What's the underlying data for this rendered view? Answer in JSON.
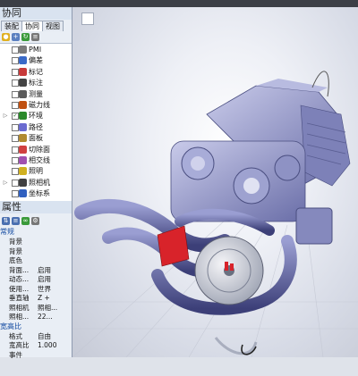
{
  "window": {
    "title": ""
  },
  "left_panel": {
    "title": "协同",
    "tabs": [
      "装配",
      "协同",
      "视图"
    ],
    "active_tab": 1,
    "tree": [
      {
        "label": "PMI",
        "checked": false,
        "expander": "",
        "icon_color": "#7a7a7a"
      },
      {
        "label": "偏差",
        "checked": false,
        "expander": "",
        "icon_color": "#3a6ac8"
      },
      {
        "label": "标记",
        "checked": false,
        "expander": "",
        "icon_color": "#c83a3a"
      },
      {
        "label": "标注",
        "checked": false,
        "expander": "",
        "icon_color": "#444"
      },
      {
        "label": "测量",
        "checked": false,
        "expander": "",
        "icon_color": "#5a5a5a"
      },
      {
        "label": "磁力线",
        "checked": false,
        "expander": "",
        "icon_color": "#c05010"
      },
      {
        "label": "环境",
        "checked": true,
        "expander": "▷",
        "icon_color": "#2a8a2a"
      },
      {
        "label": "路径",
        "checked": false,
        "expander": "",
        "icon_color": "#6a6ad0"
      },
      {
        "label": "面板",
        "checked": false,
        "expander": "",
        "icon_color": "#b08a30"
      },
      {
        "label": "切除面",
        "checked": false,
        "expander": "",
        "icon_color": "#d04040"
      },
      {
        "label": "相交线",
        "checked": false,
        "expander": "",
        "icon_color": "#a050b0"
      },
      {
        "label": "照明",
        "checked": false,
        "expander": "",
        "icon_color": "#d0b020"
      },
      {
        "label": "照相机",
        "checked": false,
        "expander": "▷",
        "icon_color": "#404040"
      },
      {
        "label": "坐标系",
        "checked": false,
        "expander": "",
        "icon_color": "#3060c0"
      }
    ],
    "properties_title": "属性",
    "properties": {
      "section1": "常规",
      "rows1": [
        {
          "k": "背景",
          "v": ""
        },
        {
          "k": "背景",
          "v": ""
        },
        {
          "k": "底色",
          "v": ""
        },
        {
          "k": "背面...",
          "v": "启用"
        },
        {
          "k": "动态...",
          "v": "启用"
        },
        {
          "k": "使用...",
          "v": "世界"
        },
        {
          "k": "垂直轴",
          "v": "Z +"
        },
        {
          "k": "照相机",
          "v": "照相..."
        },
        {
          "k": "照相...",
          "v": "22..."
        }
      ],
      "section2": "宽高比",
      "rows2": [
        {
          "k": "格式",
          "v": "自由"
        },
        {
          "k": "宽高比",
          "v": "1.000"
        },
        {
          "k": "事件",
          "v": ""
        }
      ]
    }
  },
  "colors": {
    "panel_bg": "#e9eef5",
    "viewport_bg": "#eef0f6",
    "engine_body": "#8f93c4",
    "accent_red": "#d8232a"
  }
}
